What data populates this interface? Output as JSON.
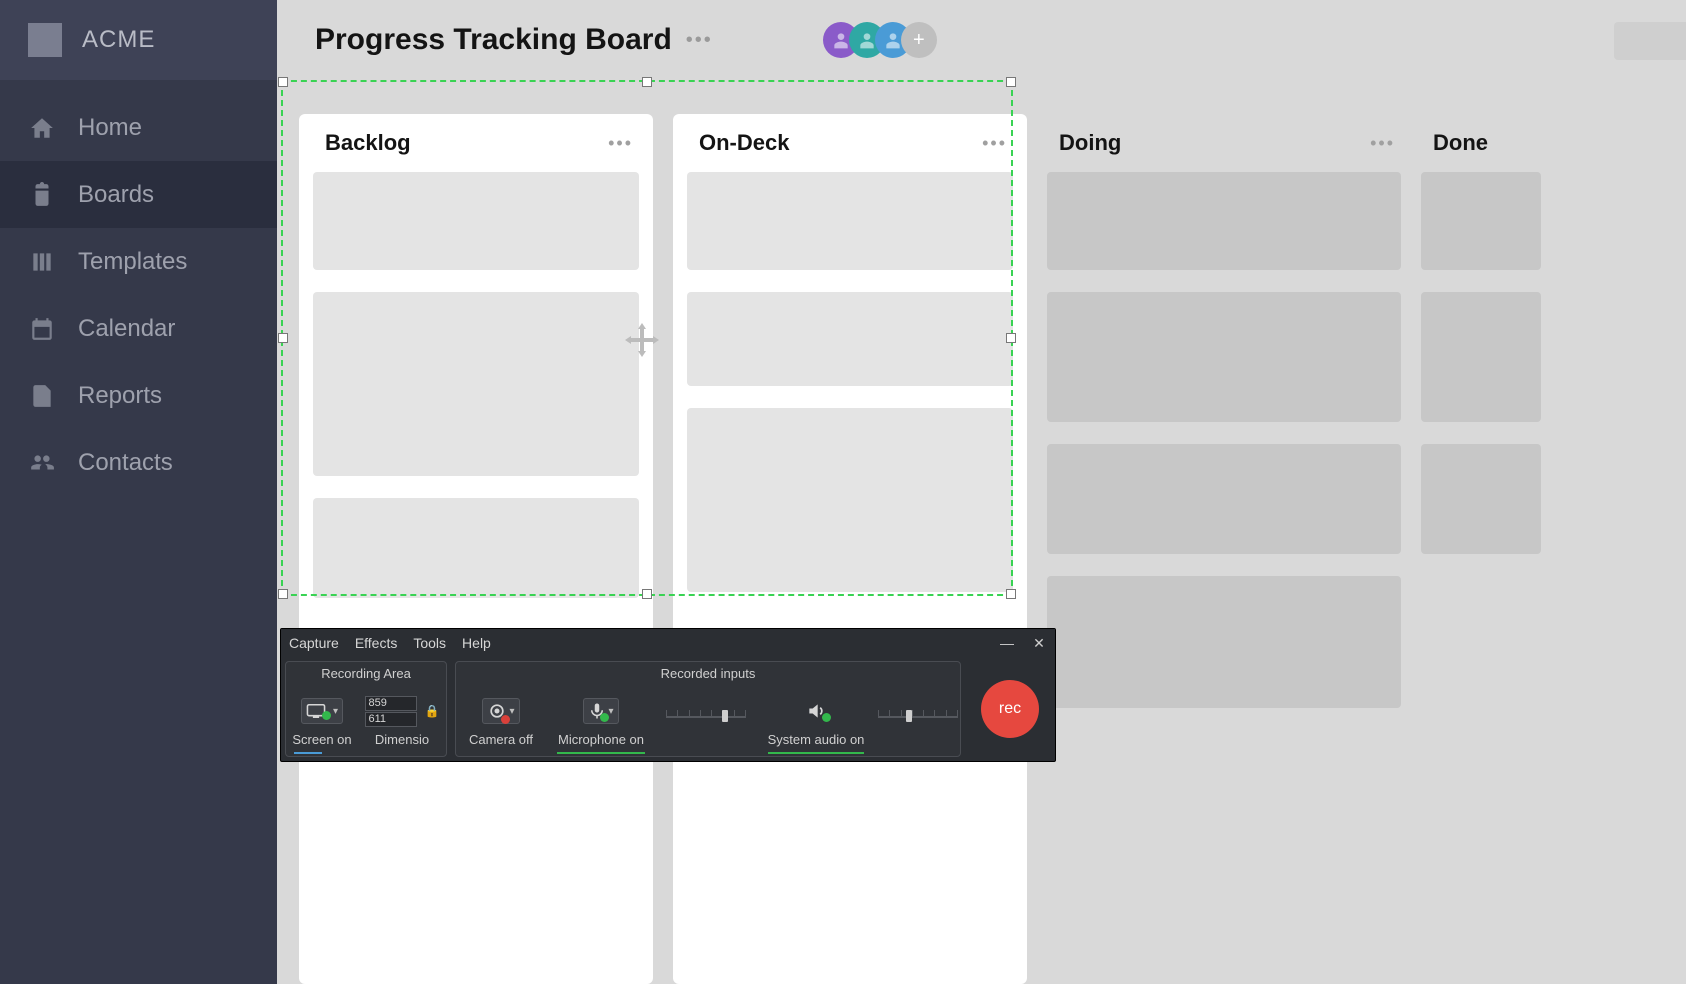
{
  "app": {
    "name": "ACME"
  },
  "nav": {
    "items": [
      {
        "label": "Home"
      },
      {
        "label": "Boards"
      },
      {
        "label": "Templates"
      },
      {
        "label": "Calendar"
      },
      {
        "label": "Reports"
      },
      {
        "label": "Contacts"
      }
    ],
    "active_index": 1
  },
  "board": {
    "title": "Progress Tracking Board",
    "columns": [
      {
        "title": "Backlog",
        "highlighted": true,
        "card_heights": [
          98,
          184,
          100
        ]
      },
      {
        "title": "On-Deck",
        "highlighted": true,
        "card_heights": [
          98,
          94,
          184
        ]
      },
      {
        "title": "Doing",
        "highlighted": false,
        "card_heights": [
          98,
          130,
          110,
          132
        ]
      },
      {
        "title": "Done",
        "highlighted": false,
        "card_heights": [
          98,
          130,
          110
        ]
      }
    ]
  },
  "avatars": {
    "add_label": "+"
  },
  "recorder": {
    "menu": {
      "capture": "Capture",
      "effects": "Effects",
      "tools": "Tools",
      "help": "Help"
    },
    "panels": {
      "area": "Recording Area",
      "inputs": "Recorded inputs"
    },
    "area": {
      "screen_label": "Screen on",
      "dimensio_label": "Dimensio",
      "width": "859",
      "height": "611"
    },
    "inputs": {
      "camera_label": "Camera off",
      "mic_label": "Microphone on",
      "audio_label": "System audio on"
    },
    "record_label": "rec"
  }
}
